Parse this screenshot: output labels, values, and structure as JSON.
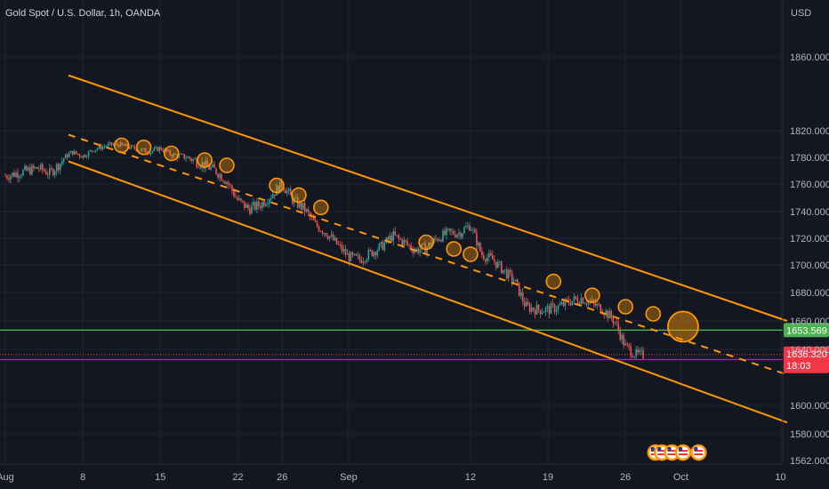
{
  "header": {
    "title": "Gold Spot / U.S. Dollar, 1h, OANDA"
  },
  "chart_data": {
    "type": "candlestick",
    "title": "Gold Spot / U.S. Dollar, 1h, OANDA",
    "currency": "USD",
    "y_ticks": [
      1860,
      1820,
      1780,
      1760,
      1740,
      1720,
      1700,
      1680,
      1660,
      1640,
      1600,
      1580
    ],
    "y_ticks_labels": [
      "1860.000",
      "1820.000",
      "1780.000",
      "1760.000",
      "1740.000",
      "1720.000",
      "1700.000",
      "1680.000",
      "1660.000",
      "1640.000",
      "1600.000",
      "1580.000"
    ],
    "y_bottom_label": "1562.000",
    "x_ticks": [
      {
        "label": "Aug",
        "day": 0
      },
      {
        "label": "8",
        "day": 7
      },
      {
        "label": "15",
        "day": 14
      },
      {
        "label": "22",
        "day": 21
      },
      {
        "label": "26",
        "day": 25
      },
      {
        "label": "Sep",
        "day": 31
      },
      {
        "label": "12",
        "day": 42
      },
      {
        "label": "19",
        "day": 49
      },
      {
        "label": "26",
        "day": 56
      },
      {
        "label": "Oct",
        "day": 61
      },
      {
        "label": "10",
        "day": 70
      }
    ],
    "close_path": [
      [
        0,
        1766
      ],
      [
        1,
        1768
      ],
      [
        2,
        1770
      ],
      [
        3,
        1772
      ],
      [
        4,
        1768
      ],
      [
        5,
        1776
      ],
      [
        6,
        1788
      ],
      [
        7,
        1782
      ],
      [
        8,
        1792
      ],
      [
        9,
        1797
      ],
      [
        10,
        1800
      ],
      [
        11,
        1796
      ],
      [
        12,
        1792
      ],
      [
        13,
        1788
      ],
      [
        14,
        1794
      ],
      [
        15,
        1784
      ],
      [
        16,
        1782
      ],
      [
        17,
        1778
      ],
      [
        18,
        1774
      ],
      [
        19,
        1770
      ],
      [
        20,
        1762
      ],
      [
        21,
        1748
      ],
      [
        22,
        1742
      ],
      [
        23,
        1745
      ],
      [
        24,
        1752
      ],
      [
        25,
        1760
      ],
      [
        26,
        1748
      ],
      [
        27,
        1742
      ],
      [
        28,
        1730
      ],
      [
        29,
        1724
      ],
      [
        30,
        1715
      ],
      [
        31,
        1706
      ],
      [
        32,
        1704
      ],
      [
        33,
        1709
      ],
      [
        34,
        1714
      ],
      [
        35,
        1722
      ],
      [
        36,
        1717
      ],
      [
        37,
        1711
      ],
      [
        38,
        1713
      ],
      [
        39,
        1720
      ],
      [
        40,
        1724
      ],
      [
        41,
        1724
      ],
      [
        42,
        1730
      ],
      [
        43,
        1708
      ],
      [
        44,
        1704
      ],
      [
        45,
        1696
      ],
      [
        46,
        1688
      ],
      [
        47,
        1670
      ],
      [
        48,
        1668
      ],
      [
        49,
        1668
      ],
      [
        50,
        1670
      ],
      [
        51,
        1674
      ],
      [
        52,
        1676
      ],
      [
        53,
        1672
      ],
      [
        54,
        1668
      ],
      [
        55,
        1660
      ],
      [
        56,
        1642
      ],
      [
        57,
        1636
      ]
    ],
    "channel": {
      "upper": [
        [
          5.7,
          1850
        ],
        [
          70.6,
          1660
        ]
      ],
      "middle": [
        [
          5.7,
          1814
        ],
        [
          70.6,
          1622
        ]
      ],
      "lower": [
        [
          5.7,
          1777
        ],
        [
          70.6,
          1588
        ]
      ],
      "color": "#ff9800"
    },
    "circles": [
      [
        10.5,
        1798
      ],
      [
        12.5,
        1795
      ],
      [
        15,
        1786
      ],
      [
        18,
        1778
      ],
      [
        20,
        1774
      ],
      [
        24.5,
        1759
      ],
      [
        26.5,
        1752
      ],
      [
        28.5,
        1743
      ],
      [
        38,
        1717
      ],
      [
        40.5,
        1712
      ],
      [
        42,
        1708
      ],
      [
        49.5,
        1688
      ],
      [
        53,
        1678
      ],
      [
        56,
        1670
      ],
      [
        58.5,
        1665
      ]
    ],
    "target_circle": [
      61.2,
      1656
    ],
    "lines": [
      {
        "name": "support-green",
        "value": 1653.569,
        "label": "1653.569",
        "color": "#4caf50"
      },
      {
        "name": "support-purple",
        "value": 1632.743,
        "label": "1632.743",
        "color": "#9c27b0"
      }
    ],
    "current_price": {
      "value": 1636.32,
      "label": "1636.320",
      "countdown": "18:03",
      "color": "#f23645"
    },
    "up_color": "#26a69a",
    "down_color": "#ef5350",
    "event_marker_days": [
      58.7,
      59.3,
      60.2,
      61.2,
      62.6
    ]
  }
}
